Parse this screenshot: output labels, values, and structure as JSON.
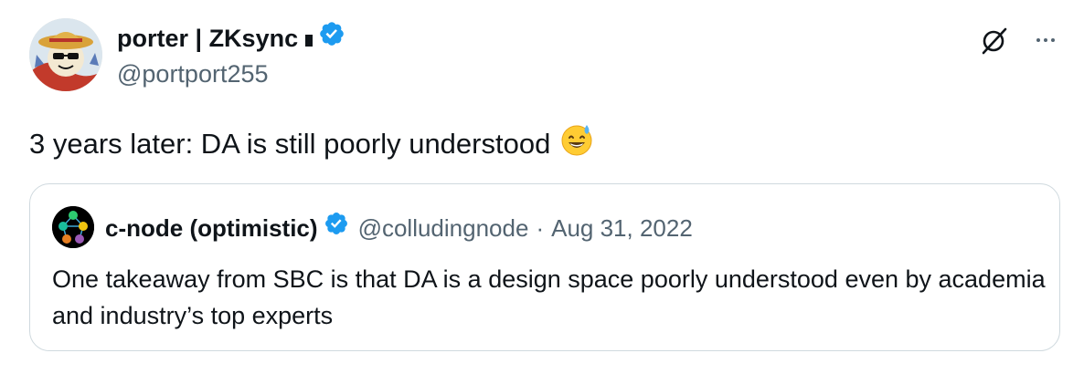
{
  "tweet": {
    "author": {
      "display_name": "porter | ZKsync",
      "handle": "@portport255",
      "verified": true,
      "avatar_icon": "pirate-cartoon-avatar"
    },
    "text": "3 years later: DA is still poorly understood",
    "emoji": "grinning-face-with-sweat",
    "actions": {
      "grok_icon": "grok-slash-icon",
      "more_icon": "more-options-icon"
    }
  },
  "quoted_tweet": {
    "author": {
      "display_name": "c-node (optimistic)",
      "handle": "@colludingnode",
      "verified": true,
      "avatar_icon": "node-graph-avatar"
    },
    "separator": "·",
    "date": "Aug 31, 2022",
    "text": "One takeaway from SBC is that DA is a design space poorly understood even by academia and industry’s top experts"
  },
  "colors": {
    "text_primary": "#0f1419",
    "text_secondary": "#536471",
    "verified_blue": "#1d9bf0",
    "border": "#cfd9de"
  }
}
